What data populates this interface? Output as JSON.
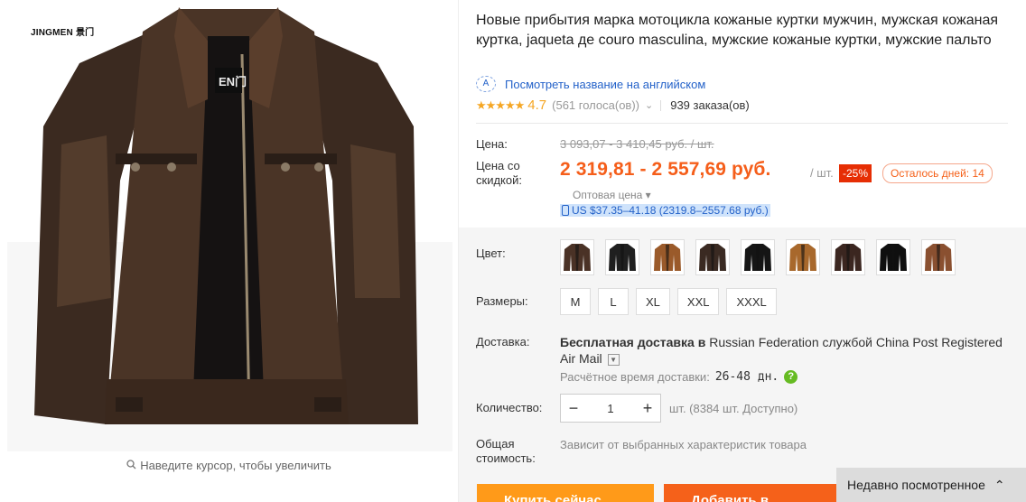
{
  "gallery": {
    "brand_logo": "JINGMEN 景门",
    "collar_label": "EN门",
    "zoom_hint": "Наведите курсор, чтобы увеличить"
  },
  "product": {
    "title": "Новые прибытия марка мотоцикла кожаные куртки мужчин, мужская кожаная куртка, jaqueta де couro masculina, мужские кожаные куртки, мужские пальто",
    "translate_link": "Посмотреть название на английском",
    "rating": {
      "stars": "★★★★★",
      "score": "4.7",
      "votes": "(561 голоса(ов))",
      "orders": "939 заказа(ов)"
    }
  },
  "price": {
    "label_price": "Цена:",
    "old_price": "3 093,07 - 3 410,45 руб. / шт.",
    "label_discount": "Цена со скидкой:",
    "new_price": "2 319,81 - 2 557,69 руб.",
    "per_unit": "/ шт.",
    "discount_badge": "-25%",
    "days_left": "Осталось дней: 14",
    "wholesale": "Оптовая цена ▾",
    "usd": "US $37.35–41.18 (2319.8–2557.68 руб.)"
  },
  "options": {
    "color_label": "Цвет:",
    "colors": [
      "#4a3226",
      "#1f1f1f",
      "#9a5a2a",
      "#3a2a22",
      "#151515",
      "#a8682c",
      "#3b2620",
      "#0f0f0f",
      "#8a5030"
    ],
    "sizes_label": "Размеры:",
    "sizes": [
      "M",
      "L",
      "XL",
      "XXL",
      "XXXL"
    ]
  },
  "shipping": {
    "label": "Доставка:",
    "free_text": "Бесплатная доставка в",
    "destination": "Russian Federation службой China Post Registered Air Mail",
    "eta_label": "Расчётное время доставки:",
    "eta_value": "26-48 дн."
  },
  "quantity": {
    "label": "Количество:",
    "minus": "−",
    "value": "1",
    "plus": "+",
    "available": "шт. (8384 шт. Доступно)"
  },
  "total": {
    "label": "Общая стоимость:",
    "note": "Зависит от выбранных характеристик товара"
  },
  "buttons": {
    "buy": "Купить сейчас",
    "cart": "Добавить в корзину"
  },
  "recently_viewed": "Недавно посмотренное"
}
